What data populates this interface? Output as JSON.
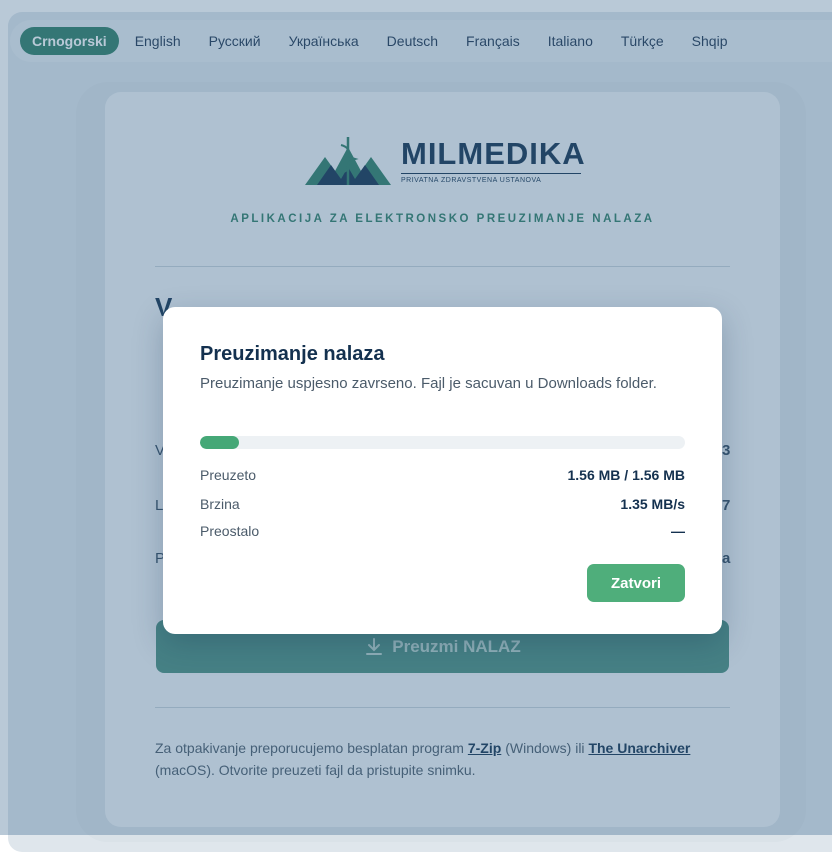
{
  "languages": [
    {
      "label": "Crnogorski",
      "active": true
    },
    {
      "label": "English"
    },
    {
      "label": "Русский"
    },
    {
      "label": "Українська"
    },
    {
      "label": "Deutsch"
    },
    {
      "label": "Français"
    },
    {
      "label": "Italiano"
    },
    {
      "label": "Türkçe"
    },
    {
      "label": "Shqip"
    }
  ],
  "brand": {
    "name": "MILMEDIKA",
    "tagline": "PRIVATNA ZDRAVSTVENA USTANOVA",
    "app_subtitle": "APLIKACIJA ZA ELEKTRONSKO PREUZIMANJE NALAZA"
  },
  "page": {
    "background_title_fragment": "V",
    "row_fragments": [
      "V",
      "L",
      "P"
    ],
    "row_values_fragments": [
      "3",
      "7",
      "a"
    ],
    "download_label": "Preuzmi NALAZ"
  },
  "footer": {
    "text_1": "Za otpakivanje preporucujemo besplatan program ",
    "link_1": "7-Zip",
    "text_2": " (Windows) ili ",
    "link_2": "The Unarchiver",
    "text_3": " (macOS). Otvorite preuzeti fajl da pristupite snimku."
  },
  "modal": {
    "title": "Preuzimanje nalaza",
    "message": "Preuzimanje uspjesno zavrseno. Fajl je sacuvan u Downloads folder.",
    "progress": 0.08,
    "rows": [
      {
        "label": "Preuzeto",
        "value": "1.56 MB / 1.56 MB"
      },
      {
        "label": "Brzina",
        "value": "1.35 MB/s"
      },
      {
        "label": "Preostalo",
        "value": "—"
      }
    ],
    "close_label": "Zatvori"
  },
  "colors": {
    "accent": "#2f7d66",
    "navy": "#14314f",
    "progress": "#45a877",
    "close_button": "#4fae7b"
  }
}
